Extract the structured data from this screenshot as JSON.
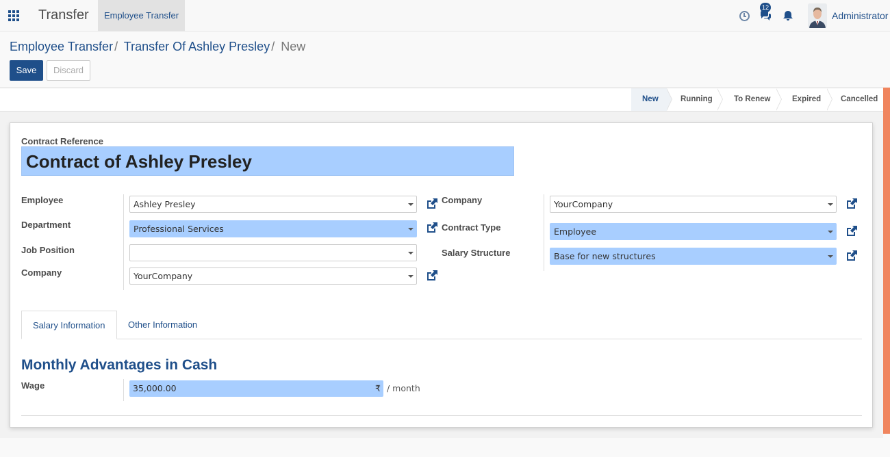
{
  "navbar": {
    "app_title": "Transfer",
    "menu_item": "Employee Transfer",
    "chat_count": "12",
    "user_name": "Administrator"
  },
  "breadcrumb": {
    "items": [
      "Employee Transfer",
      "Transfer Of Ashley Presley"
    ],
    "current": "New",
    "separator": "/"
  },
  "actions": {
    "save_label": "Save",
    "discard_label": "Discard"
  },
  "statusbar": {
    "stages": [
      "New",
      "Running",
      "To Renew",
      "Expired",
      "Cancelled"
    ],
    "active": "New"
  },
  "form": {
    "contract_reference_label": "Contract Reference",
    "contract_reference_value": "Contract of Ashley Presley",
    "left": {
      "employee_label": "Employee",
      "employee_value": "Ashley Presley",
      "department_label": "Department",
      "department_value": "Professional Services",
      "job_position_label": "Job Position",
      "job_position_value": "",
      "company_label": "Company",
      "company_value": "YourCompany"
    },
    "right": {
      "company_label": "Company",
      "company_value": "YourCompany",
      "contract_type_label": "Contract Type",
      "contract_type_value": "Employee",
      "salary_structure_label": "Salary Structure",
      "salary_structure_value": "Base for new structures"
    },
    "tabs": [
      "Salary Information",
      "Other Information"
    ],
    "active_tab": "Salary Information",
    "section_title": "Monthly Advantages in Cash",
    "wage_label": "Wage",
    "wage_value": "35,000.00",
    "currency_symbol": "₹",
    "wage_period": "/ month"
  },
  "colors": {
    "brand": "#1f4f8a",
    "required_field": "#a8ceff",
    "scrollbar_accent": "#f0855e"
  }
}
